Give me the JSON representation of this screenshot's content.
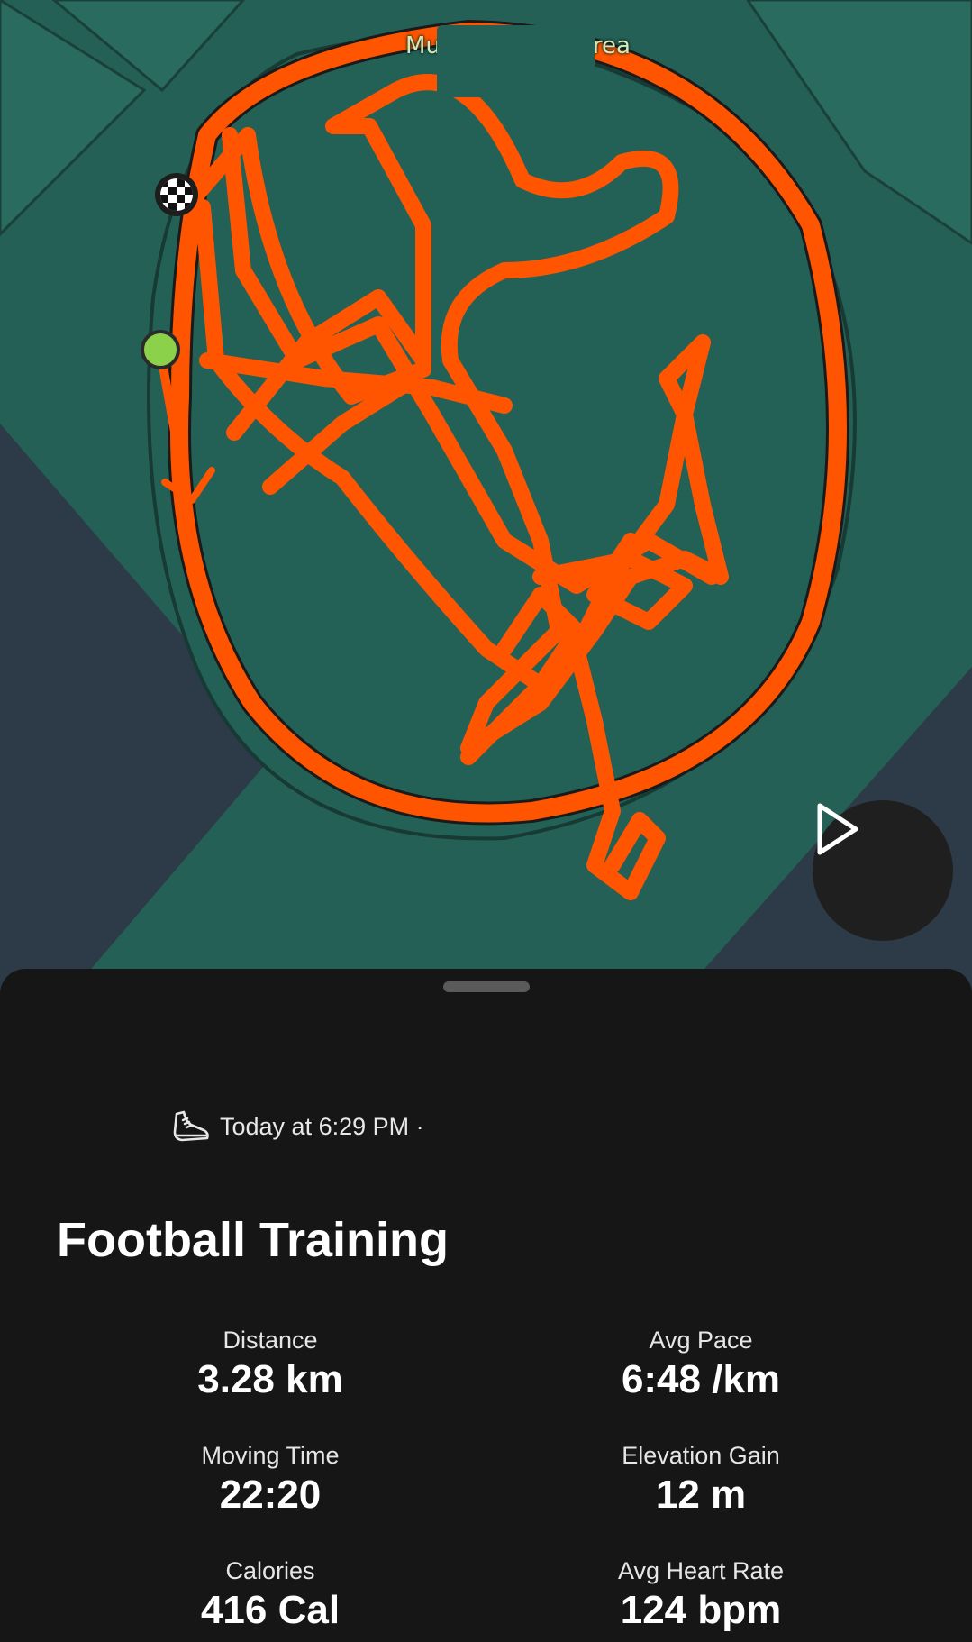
{
  "map": {
    "label": "Multi Sporting Area",
    "colors": {
      "route": "#ff5500",
      "field": "#236157",
      "background": "#2d3a48",
      "start_marker": "#8bd14a"
    },
    "markers": {
      "start": "green-dot-icon",
      "finish": "checkered-flag-icon",
      "direction": "arrow-down-icon"
    },
    "play_icon": "play-icon"
  },
  "activity": {
    "icon": "running-shoe-icon",
    "timestamp": "Today at 6:29 PM ·",
    "title": "Football Training"
  },
  "stats": [
    {
      "label": "Distance",
      "value": "3.28 km"
    },
    {
      "label": "Avg Pace",
      "value": "6:48 /km"
    },
    {
      "label": "Moving Time",
      "value": "22:20"
    },
    {
      "label": "Elevation Gain",
      "value": "12 m"
    },
    {
      "label": "Calories",
      "value": "416 Cal"
    },
    {
      "label": "Avg Heart Rate",
      "value": "124 bpm"
    }
  ]
}
